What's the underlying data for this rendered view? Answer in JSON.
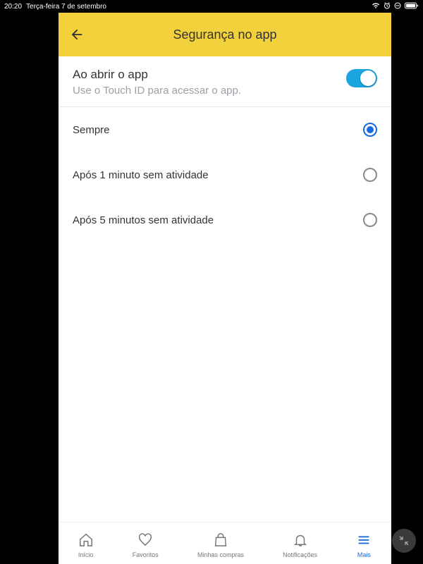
{
  "statusbar": {
    "time": "20:20",
    "date": "Terça-feira 7 de setembro"
  },
  "nav": {
    "title": "Segurança no app"
  },
  "section": {
    "title": "Ao abrir o app",
    "subtitle": "Use o Touch ID para acessar o app."
  },
  "options": [
    {
      "label": "Sempre",
      "selected": true
    },
    {
      "label": "Após 1 minuto sem atividade",
      "selected": false
    },
    {
      "label": "Após 5 minutos sem atividade",
      "selected": false
    }
  ],
  "tabs": {
    "inicio": "Início",
    "favoritos": "Favoritos",
    "compras": "Minhas compras",
    "notificacoes": "Notificações",
    "mais": "Mais"
  }
}
